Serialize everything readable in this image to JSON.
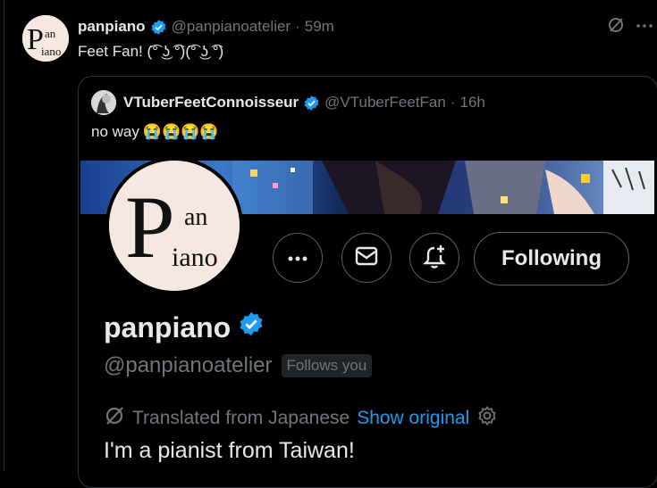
{
  "post": {
    "author_name": "panpiano",
    "handle": "@panpianoatelier",
    "separator": "·",
    "time": "59m",
    "text": "Feet Fan! (͡° ͜ʖ ͡°)(͡° ͜ʖ ͡°)",
    "more_icon": "more-horizontal-icon",
    "grok_icon": "slash-circle-icon"
  },
  "quote": {
    "author_name": "VTuberFeetConnoisseur",
    "handle": "@VTuberFeetFan",
    "separator": "·",
    "time": "16h",
    "text": "no way",
    "emojis": [
      "😭",
      "😭",
      "😭",
      "😭"
    ]
  },
  "profile": {
    "avatar_logo": {
      "p": "P",
      "an": "an",
      "iano": "iano"
    },
    "following_label": "Following",
    "name": "panpiano",
    "handle": "@panpianoatelier",
    "follows_you": "Follows you",
    "translated_label": "Translated from Japanese",
    "show_original": "Show original",
    "bio": "I'm a pianist from Taiwan!"
  },
  "colors": {
    "background": "#000000",
    "text": "#e7e9ea",
    "muted": "#71767b",
    "accent": "#1d9bf0",
    "border": "#2f3336"
  }
}
